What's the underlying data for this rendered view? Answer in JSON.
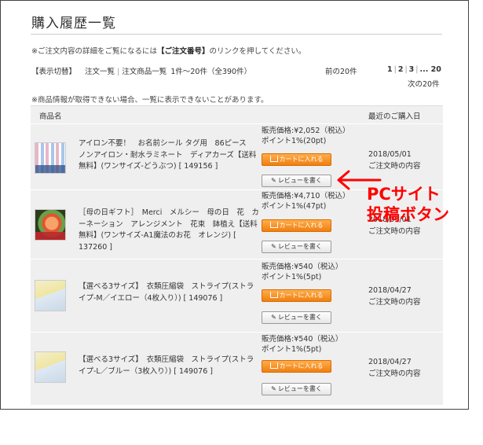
{
  "page": {
    "title": "購入履歴一覧"
  },
  "notice": {
    "prefix": "※ご注文内容の詳細をご覧になるには",
    "emphasis": "【ご注文番号】",
    "suffix": "のリンクを押してください。"
  },
  "toolbar": {
    "view_switch": "【表示切替】",
    "order_list": "注文一覧",
    "product_list": "注文商品一覧",
    "range": "1件～20件（全390件）",
    "prev": "前の20件",
    "pages": [
      "1",
      "2",
      "3",
      "... 20"
    ],
    "next": "次の20件"
  },
  "note_unavailable": "※商品情報が取得できない場合、一覧に表示できないことがあります。",
  "table": {
    "col_product": "商品名",
    "col_date": "最近のご購入日"
  },
  "items": [
    {
      "name": "アイロン不要！　お名前シール タグ用　86ピース　ノンアイロン・耐水ラミネート　ディアカーズ【送料無料】(ワンサイズ-どうぶつ) [ 149156 ]",
      "price": "販売価格:¥2,052（税込）",
      "points": "ポイント1%(20pt)",
      "cart_label": "カートに入れる",
      "review_label": "レビューを書く",
      "date": "2018/05/01",
      "status": "ご注文時の内容"
    },
    {
      "name": "［母の日ギフト］　Merci　メルシー　母の日　花　カーネーション　アレンジメント　花束　鉢植え【送料無料】(ワンサイズ-A1魔法のお花　オレンジ) [ 137260 ]",
      "price": "販売価格:¥4,710（税込）",
      "points": "ポイント1%(47pt)",
      "cart_label": "カートに入れる",
      "review_label": "レビューを書く",
      "date": "2018/05/01",
      "status": "ご注文時の内容"
    },
    {
      "name": "【選べる3サイズ】　衣類圧縮袋　ストライプ(ストライプ-M／イエロー（4枚入り）) [ 149076 ]",
      "price": "販売価格:¥540（税込）",
      "points": "ポイント1%(5pt)",
      "cart_label": "カートに入れる",
      "review_label": "レビューを書く",
      "date": "2018/04/27",
      "status": "ご注文時の内容"
    },
    {
      "name": "【選べる3サイズ】　衣類圧縮袋　ストライプ(ストライプ-L／ブルー（3枚入り）) [ 149076 ]",
      "price": "販売価格:¥540（税込）",
      "points": "ポイント1%(5pt)",
      "cart_label": "カートに入れる",
      "review_label": "レビューを書く",
      "date": "2018/04/27",
      "status": "ご注文時の内容"
    }
  ],
  "annotation": {
    "line1": "PCサイト",
    "line2": "投稿ボタン",
    "color": "#ff0000"
  },
  "colors": {
    "cart_button": "#f28a1c",
    "accent_red": "#ff0000"
  }
}
